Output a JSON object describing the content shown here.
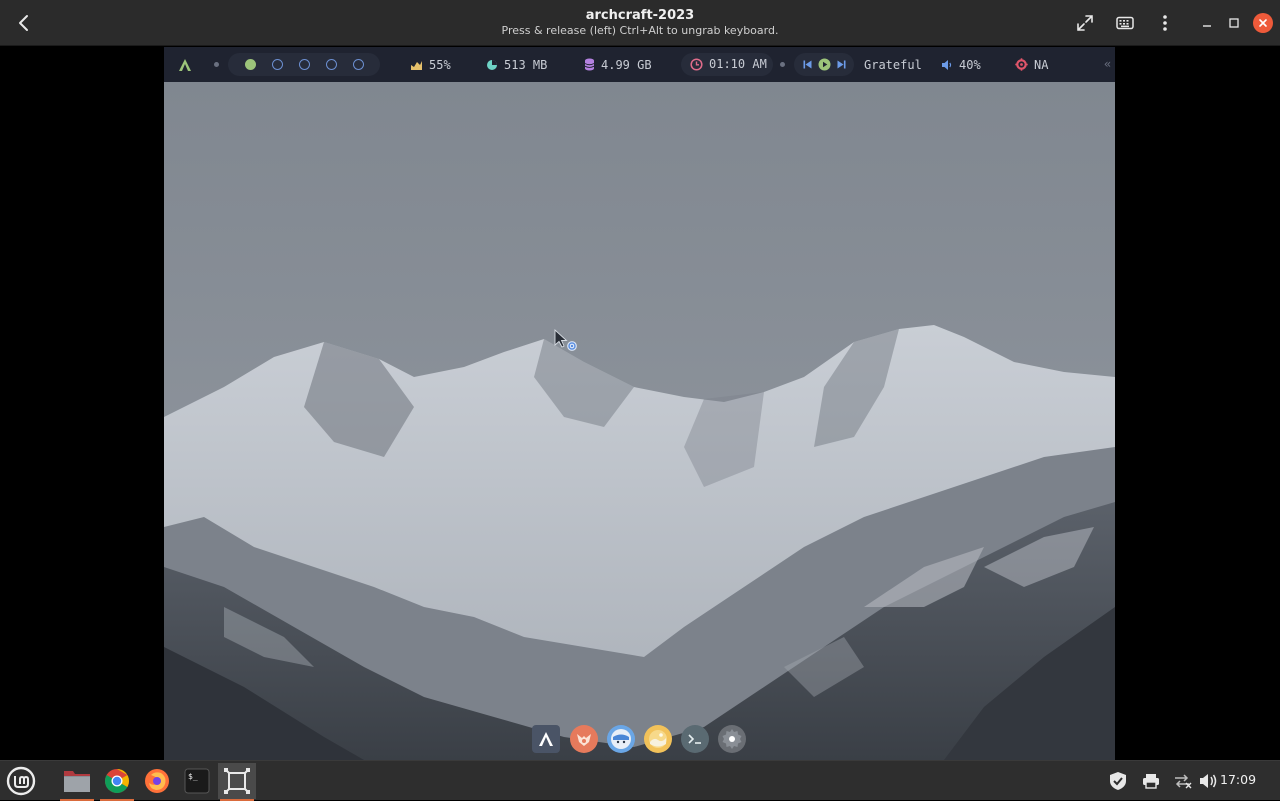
{
  "window": {
    "title": "archcraft-2023",
    "subtitle": "Press & release (left) Ctrl+Alt to ungrab keyboard."
  },
  "titlebar_icons": [
    "back-arrow-icon",
    "fullscreen-icon",
    "keyboard-icon",
    "kebab-menu-icon",
    "minimize-icon",
    "maximize-icon",
    "close-icon"
  ],
  "polybar": {
    "workspaces": [
      {
        "active": true
      },
      {
        "active": false
      },
      {
        "active": false
      },
      {
        "active": false
      },
      {
        "active": false
      }
    ],
    "cpu": "55%",
    "memory": "513 MB",
    "disk": "4.99 GB",
    "time": "01:10 AM",
    "track": "Grateful",
    "volume": "40%",
    "network": "NA",
    "colors": {
      "bar_bg": "#1f2330",
      "module_bg": "#272c3a",
      "cpu": "#e5c06b",
      "memory": "#6ed3c6",
      "disk": "#b481e0",
      "clock": "#e06c8a",
      "media": "#6c9be8",
      "volume": "#6c9be8",
      "network": "#e0556a",
      "workspace_active": "#9cc47a"
    }
  },
  "dock_icons": [
    "archcraft-icon",
    "firefox-icon",
    "file-manager-icon",
    "image-viewer-icon",
    "terminal-icon",
    "settings-icon"
  ],
  "taskbar": {
    "apps": [
      "mint-menu-icon",
      "files-icon",
      "chrome-icon",
      "firefox-icon",
      "terminal-icon",
      "gnome-boxes-icon"
    ],
    "tray": [
      "shield-icon",
      "printer-icon",
      "network-icon",
      "volume-icon"
    ],
    "clock": "17:09"
  }
}
